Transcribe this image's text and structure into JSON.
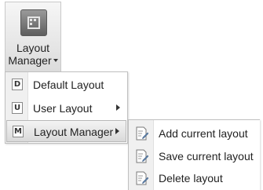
{
  "ribbon": {
    "button_label_line1": "Layout",
    "button_label_line2": "Manager",
    "icon": "layout-manager-icon"
  },
  "menu": {
    "items": [
      {
        "badge": "D",
        "label": "Default Layout",
        "has_submenu": false
      },
      {
        "badge": "U",
        "label": "User Layout",
        "has_submenu": true
      },
      {
        "badge": "M",
        "label": "Layout Manager",
        "has_submenu": true,
        "active": true
      }
    ]
  },
  "submenu": {
    "items": [
      {
        "label": "Add current layout",
        "icon": "document-edit-icon"
      },
      {
        "label": "Save current layout",
        "icon": "document-edit-icon"
      },
      {
        "label": "Delete layout",
        "icon": "document-edit-icon"
      }
    ]
  },
  "colors": {
    "hover_gradient_top": "#f4f4f4",
    "hover_gradient_bottom": "#d9d9d9",
    "gutter": "#f0f0f0",
    "icon_dark": "#5e5e5e"
  }
}
